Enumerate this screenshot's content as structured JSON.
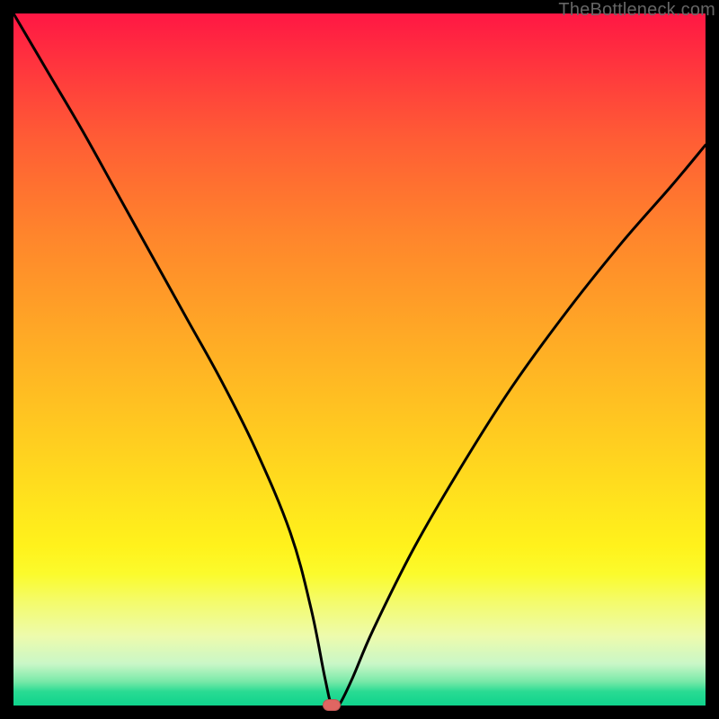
{
  "watermark": "TheBottleneck.com",
  "marker": {
    "x_pct": 46,
    "y_pct": 100
  },
  "chart_data": {
    "type": "line",
    "title": "",
    "xlabel": "",
    "ylabel": "",
    "xlim": [
      0,
      100
    ],
    "ylim": [
      0,
      100
    ],
    "grid": false,
    "legend": false,
    "annotations": [],
    "series": [
      {
        "name": "bottleneck-curve",
        "x": [
          0,
          5,
          10,
          15,
          20,
          25,
          30,
          35,
          40,
          43,
          45,
          46,
          47,
          49,
          52,
          58,
          65,
          72,
          80,
          88,
          95,
          100
        ],
        "values": [
          100,
          91.5,
          83,
          74,
          65,
          56,
          47,
          37,
          25,
          14,
          4,
          0,
          0,
          4,
          11,
          23,
          35,
          46,
          57,
          67,
          75,
          81
        ]
      }
    ],
    "background_gradient": {
      "stops": [
        {
          "pct": 0,
          "color": "#ff1744"
        },
        {
          "pct": 25,
          "color": "#ff7130"
        },
        {
          "pct": 48,
          "color": "#ffad25"
        },
        {
          "pct": 71,
          "color": "#ffe41d"
        },
        {
          "pct": 85,
          "color": "#f4fb6b"
        },
        {
          "pct": 96,
          "color": "#7ae9a9"
        },
        {
          "pct": 100,
          "color": "#0fd38c"
        }
      ]
    },
    "marker": {
      "x": 46,
      "y": 0,
      "color": "#e06662"
    }
  }
}
